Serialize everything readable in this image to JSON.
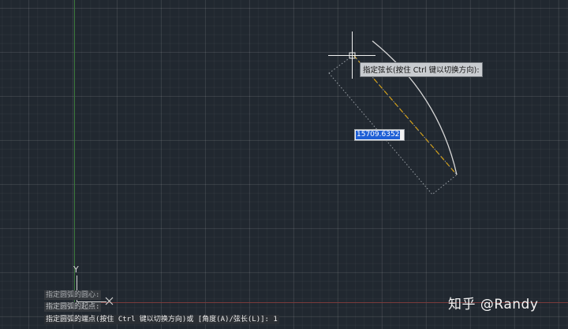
{
  "colors": {
    "background": "#212830",
    "arc": "#d8d8d8",
    "chord_dashed": "#d4a017",
    "dotted_box": "#9aa0a6",
    "ucs_y_axis": "#3d7a3d",
    "ucs_x_axis": "#7a3b3b",
    "selection": "#1e5fd6"
  },
  "tooltip": {
    "text": "指定弦长(按住 Ctrl 键以切换方向):"
  },
  "dynamic_input": {
    "value": "15709.6352"
  },
  "ucs": {
    "y_label": "Y",
    "icon": "x-cross-icon"
  },
  "command_history": [
    "指定圆弧的圆心:",
    "指定圆弧的起点:",
    "指定圆弧的端点(按住 Ctrl 键以切换方向)或 [角度(A)/弦长(L)]: 1"
  ],
  "watermark": "知乎 @Randy",
  "icons": {
    "cursor": "crosshair-cursor-icon"
  }
}
